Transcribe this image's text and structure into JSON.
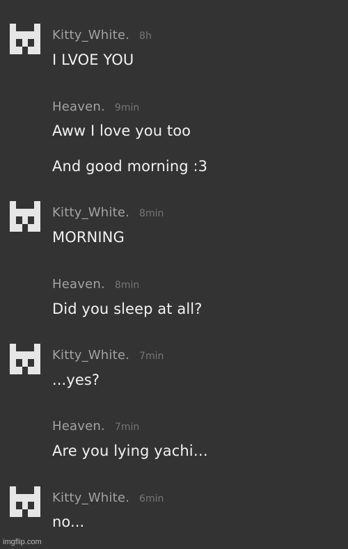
{
  "messages": [
    {
      "username": "Kitty_White.",
      "time": "8h",
      "lines": [
        "I LVOE YOU"
      ],
      "has_avatar": true
    },
    {
      "username": "Heaven.",
      "time": "9min",
      "lines": [
        "Aww I love you too",
        "And good morning :3"
      ],
      "has_avatar": false
    },
    {
      "username": "Kitty_White.",
      "time": "8min",
      "lines": [
        "MORNING"
      ],
      "has_avatar": true
    },
    {
      "username": "Heaven.",
      "time": "8min",
      "lines": [
        "Did you sleep at all?"
      ],
      "has_avatar": false
    },
    {
      "username": "Kitty_White.",
      "time": "7min",
      "lines": [
        "...yes?"
      ],
      "has_avatar": true
    },
    {
      "username": "Heaven.",
      "time": "7min",
      "lines": [
        "Are you lying yachi…"
      ],
      "has_avatar": false
    },
    {
      "username": "Kitty_White.",
      "time": "6min",
      "lines": [
        "no..."
      ],
      "has_avatar": true
    }
  ],
  "watermark": "imgflip.com",
  "colors": {
    "background": "#333333",
    "username": "#a3a3a3",
    "timestamp": "#777777",
    "message_text": "#f1f1f1",
    "avatar": "#e6e6e6"
  },
  "avatar_icon": "pixel-castle-icon"
}
